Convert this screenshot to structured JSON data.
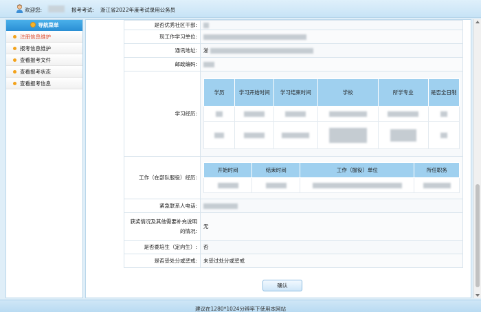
{
  "header": {
    "welcome": "欢迎您:",
    "exam_label": "报考考试:",
    "exam_name": "浙江省2022年度考试录用公务员"
  },
  "sidebar": {
    "title": "导航菜单",
    "items": [
      {
        "label": "注册信息维护",
        "active": true
      },
      {
        "label": "报考信息维护",
        "active": false
      },
      {
        "label": "查看报考文件",
        "active": false
      },
      {
        "label": "查看报考状态",
        "active": false
      },
      {
        "label": "查看报考信息",
        "active": false
      }
    ]
  },
  "form": {
    "community_cadre_label": "是否优秀社区干部:",
    "workplace_label": "现工作学习单位:",
    "address_label": "通讯地址:",
    "address_prefix": "浙",
    "postcode_label": "邮政编码:",
    "study_label": "学习经历:",
    "study_headers": [
      "学历",
      "学习开始时间",
      "学习结束时间",
      "学校",
      "所学专业",
      "是否全日制"
    ],
    "work_label": "工作（在部队服役）经历:",
    "work_headers": [
      "开始时间",
      "结束时间",
      "工作（服役）单位",
      "所任职务"
    ],
    "emergency_label": "紧急联系人电话:",
    "awards_label": "获奖情况及其他需要补充说明的情况:",
    "awards_value": "无",
    "directed_label": "是否委培生（定向生）:",
    "directed_value": "否",
    "punish_label": "是否受处分或惩戒:",
    "punish_value": "未受过处分或惩戒"
  },
  "buttons": {
    "confirm": "确认"
  },
  "footer": {
    "note": "建议在1280*1024分辨率下使用本网站"
  }
}
